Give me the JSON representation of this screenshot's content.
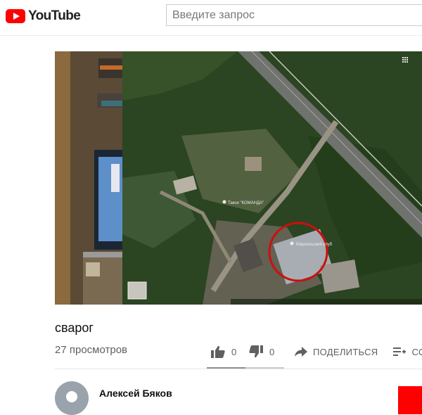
{
  "header": {
    "logo_text": "YouTube",
    "search_placeholder": "Введите запрос"
  },
  "video": {
    "title": "сварог",
    "views": "27 просмотров",
    "likes": "0",
    "dislikes": "0",
    "share_label": "ПОДЕЛИТЬСЯ",
    "save_label_partial": "СС",
    "map_labels": {
      "marker": "Марсельский клуб",
      "taxi": "Такси \"КОМАНДА\""
    }
  },
  "channel": {
    "name": "Алексей Бяков"
  },
  "colors": {
    "brand_red": "#ff0000",
    "circle_red": "#e01010",
    "icon_gray": "#606060"
  }
}
